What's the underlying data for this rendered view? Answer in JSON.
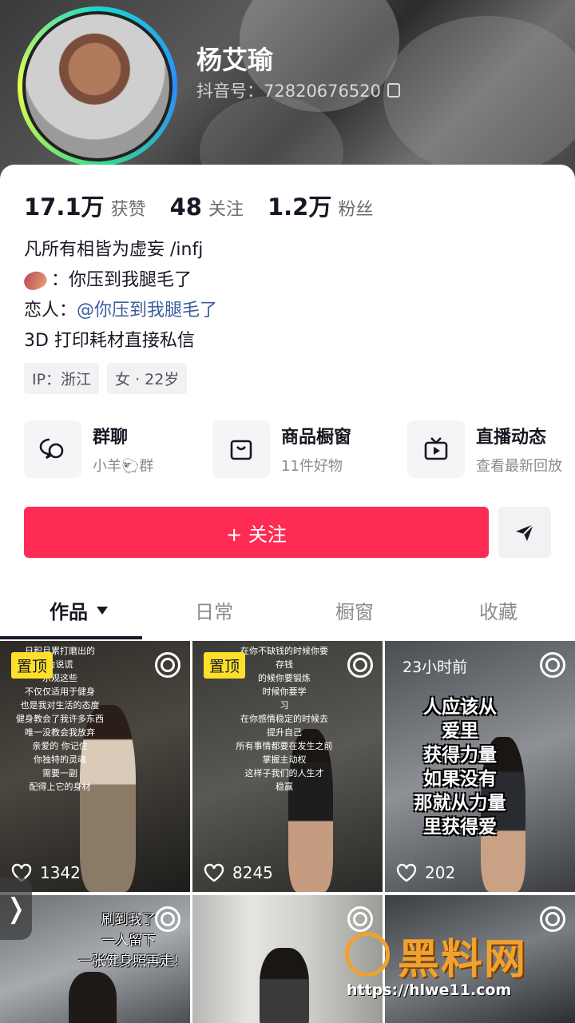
{
  "profile": {
    "name": "杨艾瑜",
    "douyin_id": "抖音号：72820676520"
  },
  "stats": [
    {
      "num": "17.1万",
      "label": "获赞"
    },
    {
      "num": "48",
      "label": "关注"
    },
    {
      "num": "1.2万",
      "label": "粉丝"
    }
  ],
  "bio": {
    "line1": "凡所有相皆为虚妄 /infj",
    "line2": "：你压到我腿毛了",
    "line3_prefix": "恋人：",
    "line3_mention": "@你压到我腿毛了",
    "line4": "3D 打印耗材直接私信"
  },
  "tags": [
    "IP：浙江",
    "女 · 22岁"
  ],
  "features": [
    {
      "title": "群聊",
      "sub": "小羊🐑群",
      "icon": "chat-bubbles-icon"
    },
    {
      "title": "商品橱窗",
      "sub": "11件好物",
      "icon": "shopping-bag-icon"
    },
    {
      "title": "直播动态",
      "sub": "查看最新回放",
      "icon": "tv-icon"
    }
  ],
  "actions": {
    "follow": "+ 关注"
  },
  "tabs": [
    "作品",
    "日常",
    "橱窗",
    "收藏"
  ],
  "videos": [
    {
      "pin": "置顶",
      "likes": "1342",
      "overlay": "日积月累打磨出的\n会说谎\n乐观这些\n不仅仅适用于健身\n也是我对生活的态度\n健身教会了我许多东西\n唯一没教会我放弃\n亲爱的 你记住\n你独特的灵魂\n需要一副\n配得上它的身材"
    },
    {
      "pin": "置顶",
      "likes": "8245",
      "overlay": "在你不缺钱的时候你要\n存钱\n的候你要锻炼\n时候你要学\n习\n在你感情稳定的时候去\n提升自己\n所有事情都要在发生之前\n掌握主动权\n这样子我们的人生才\n稳赢"
    },
    {
      "time": "23小时前",
      "likes": "202",
      "overlay": "人应该从\n爱里\n获得力量\n如果没有\n那就从力量\n里获得爱"
    },
    {
      "overlay": "刷到我了\n一人留下\n一张健身照再走!"
    },
    {},
    {}
  ],
  "watermark": {
    "text": "黑料网",
    "url": "https://hlwe11.com"
  },
  "colors": {
    "accent": "#fe2c55",
    "pin": "#fce029",
    "mention": "#3c5e9e"
  }
}
